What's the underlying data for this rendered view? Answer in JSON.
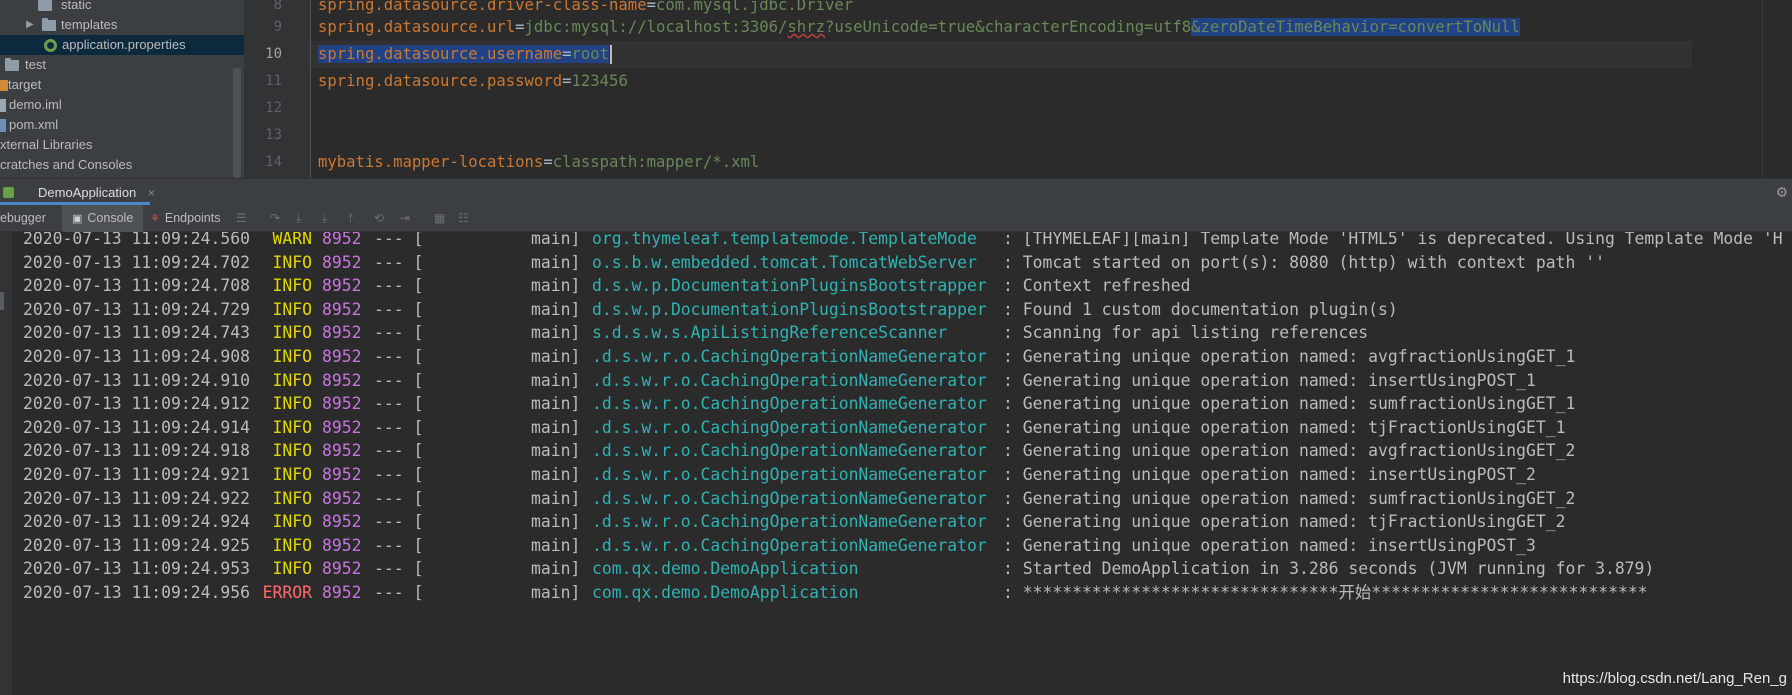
{
  "project_tree": {
    "items": [
      {
        "label": "static",
        "kind": "folder",
        "arrow": ""
      },
      {
        "label": "templates",
        "kind": "folder",
        "arrow": "▶"
      },
      {
        "label": "application.properties",
        "kind": "properties",
        "arrow": ""
      },
      {
        "label": "test",
        "kind": "folder",
        "arrow": ""
      },
      {
        "label": "target",
        "kind": "target",
        "arrow": ""
      },
      {
        "label": "demo.iml",
        "kind": "file",
        "arrow": ""
      },
      {
        "label": "pom.xml",
        "kind": "xml",
        "arrow": ""
      },
      {
        "label": "xternal Libraries",
        "kind": "none",
        "arrow": ""
      },
      {
        "label": "cratches and Consoles",
        "kind": "none",
        "arrow": ""
      }
    ]
  },
  "editor": {
    "lines": [
      {
        "num": "8",
        "key": "spring.datasource.driver-class-name",
        "value": "com.mysql.jdbc.Driver"
      },
      {
        "num": "9",
        "key": "spring.datasource.url",
        "value_a": "jdbc:mysql://localhost:3306/",
        "value_b": "shrz",
        "value_c": "?useUnicode=true&characterEncoding=utf8",
        "value_sel": "&zeroDateTimeBehavior=convertToNull"
      },
      {
        "num": "10",
        "key": "spring.datasource.username",
        "value": "root"
      },
      {
        "num": "11",
        "key": "spring.datasource.password",
        "value": "123456"
      },
      {
        "num": "12"
      },
      {
        "num": "13"
      },
      {
        "num": "14",
        "key": "mybatis.mapper-locations",
        "value": "classpath:mapper/*.xml"
      }
    ]
  },
  "run_window": {
    "tab_title": "DemoApplication",
    "close": "×",
    "toolbar": {
      "debugger": "ebugger",
      "console": "Console",
      "endpoints": "Endpoints"
    }
  },
  "console": {
    "rows": [
      {
        "ts": "2020-07-13 11:09:24.560",
        "level": "WARN",
        "pid": "8952",
        "sep": "--- [",
        "thread": "main]",
        "logger": "org.thymeleaf.templatemode.TemplateMode",
        "msg": ": [THYMELEAF][main] Template Mode 'HTML5' is deprecated. Using Template Mode 'H"
      },
      {
        "ts": "2020-07-13 11:09:24.702",
        "level": "INFO",
        "pid": "8952",
        "sep": "--- [",
        "thread": "main]",
        "logger": "o.s.b.w.embedded.tomcat.TomcatWebServer",
        "msg": ": Tomcat started on port(s): 8080 (http) with context path ''"
      },
      {
        "ts": "2020-07-13 11:09:24.708",
        "level": "INFO",
        "pid": "8952",
        "sep": "--- [",
        "thread": "main]",
        "logger": "d.s.w.p.DocumentationPluginsBootstrapper",
        "msg": ": Context refreshed"
      },
      {
        "ts": "2020-07-13 11:09:24.729",
        "level": "INFO",
        "pid": "8952",
        "sep": "--- [",
        "thread": "main]",
        "logger": "d.s.w.p.DocumentationPluginsBootstrapper",
        "msg": ": Found 1 custom documentation plugin(s)"
      },
      {
        "ts": "2020-07-13 11:09:24.743",
        "level": "INFO",
        "pid": "8952",
        "sep": "--- [",
        "thread": "main]",
        "logger": "s.d.s.w.s.ApiListingReferenceScanner",
        "msg": ": Scanning for api listing references"
      },
      {
        "ts": "2020-07-13 11:09:24.908",
        "level": "INFO",
        "pid": "8952",
        "sep": "--- [",
        "thread": "main]",
        "logger": ".d.s.w.r.o.CachingOperationNameGenerator",
        "msg": ": Generating unique operation named: avgfractionUsingGET_1"
      },
      {
        "ts": "2020-07-13 11:09:24.910",
        "level": "INFO",
        "pid": "8952",
        "sep": "--- [",
        "thread": "main]",
        "logger": ".d.s.w.r.o.CachingOperationNameGenerator",
        "msg": ": Generating unique operation named: insertUsingPOST_1"
      },
      {
        "ts": "2020-07-13 11:09:24.912",
        "level": "INFO",
        "pid": "8952",
        "sep": "--- [",
        "thread": "main]",
        "logger": ".d.s.w.r.o.CachingOperationNameGenerator",
        "msg": ": Generating unique operation named: sumfractionUsingGET_1"
      },
      {
        "ts": "2020-07-13 11:09:24.914",
        "level": "INFO",
        "pid": "8952",
        "sep": "--- [",
        "thread": "main]",
        "logger": ".d.s.w.r.o.CachingOperationNameGenerator",
        "msg": ": Generating unique operation named: tjFractionUsingGET_1"
      },
      {
        "ts": "2020-07-13 11:09:24.918",
        "level": "INFO",
        "pid": "8952",
        "sep": "--- [",
        "thread": "main]",
        "logger": ".d.s.w.r.o.CachingOperationNameGenerator",
        "msg": ": Generating unique operation named: avgfractionUsingGET_2"
      },
      {
        "ts": "2020-07-13 11:09:24.921",
        "level": "INFO",
        "pid": "8952",
        "sep": "--- [",
        "thread": "main]",
        "logger": ".d.s.w.r.o.CachingOperationNameGenerator",
        "msg": ": Generating unique operation named: insertUsingPOST_2"
      },
      {
        "ts": "2020-07-13 11:09:24.922",
        "level": "INFO",
        "pid": "8952",
        "sep": "--- [",
        "thread": "main]",
        "logger": ".d.s.w.r.o.CachingOperationNameGenerator",
        "msg": ": Generating unique operation named: sumfractionUsingGET_2"
      },
      {
        "ts": "2020-07-13 11:09:24.924",
        "level": "INFO",
        "pid": "8952",
        "sep": "--- [",
        "thread": "main]",
        "logger": ".d.s.w.r.o.CachingOperationNameGenerator",
        "msg": ": Generating unique operation named: tjFractionUsingGET_2"
      },
      {
        "ts": "2020-07-13 11:09:24.925",
        "level": "INFO",
        "pid": "8952",
        "sep": "--- [",
        "thread": "main]",
        "logger": ".d.s.w.r.o.CachingOperationNameGenerator",
        "msg": ": Generating unique operation named: insertUsingPOST_3"
      },
      {
        "ts": "2020-07-13 11:09:24.953",
        "level": "INFO",
        "pid": "8952",
        "sep": "--- [",
        "thread": "main]",
        "logger": "com.qx.demo.DemoApplication",
        "msg": ": Started DemoApplication in 3.286 seconds (JVM running for 3.879)"
      },
      {
        "ts": "2020-07-13 11:09:24.956",
        "level": "ERROR",
        "pid": "8952",
        "sep": "--- [",
        "thread": "main]",
        "logger": "com.qx.demo.DemoApplication",
        "msg": ": ********************************开始****************************"
      }
    ]
  },
  "watermark": "https://blog.csdn.net/Lang_Ren_g",
  "colors": {
    "background": "#2b2b2b",
    "panel": "#3c3f41",
    "keyword": "#cc7832",
    "string": "#6a8759",
    "logger": "#2fb2b2",
    "level": "#e0d800",
    "error": "#ff6b68",
    "pid": "#c677dd",
    "selection": "#214283"
  }
}
